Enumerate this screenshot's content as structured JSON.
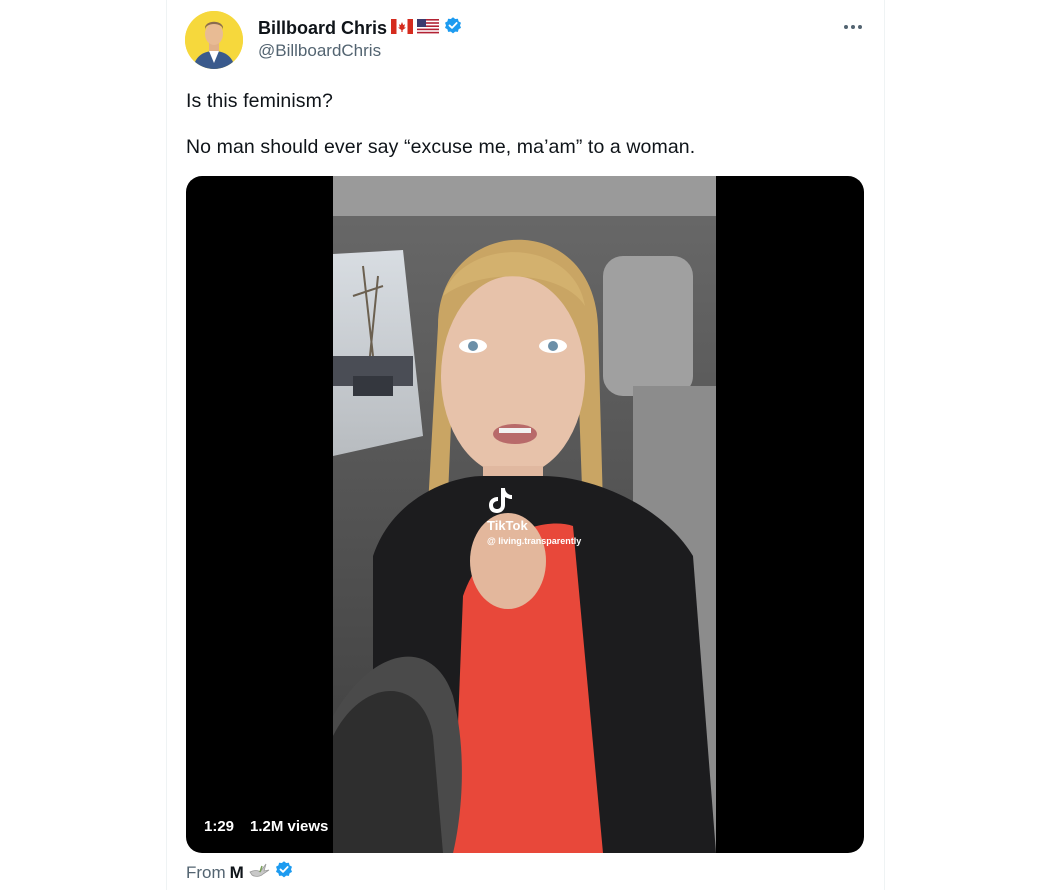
{
  "author": {
    "name": "Billboard Chris",
    "handle": "@BillboardChris",
    "flags": [
      "canada-flag-icon",
      "us-flag-icon"
    ],
    "verified_icon": "verified-badge-icon"
  },
  "tweet": {
    "lines": [
      "Is this feminism?",
      "No man should ever say “excuse me, ma’am” to a woman."
    ]
  },
  "media": {
    "duration": "1:29",
    "views": "1.2M views",
    "watermark": {
      "brand": "TikTok",
      "user": "@ living.transparently"
    }
  },
  "source": {
    "prefix": "From",
    "name": "M",
    "icon": "dove-icon",
    "verified_icon": "verified-badge-icon"
  },
  "colors": {
    "text": "#0f1419",
    "secondary": "#536471",
    "verified": "#1d9bf0",
    "avatar_bg": "#f6d83c",
    "dress": "#e8483a"
  }
}
